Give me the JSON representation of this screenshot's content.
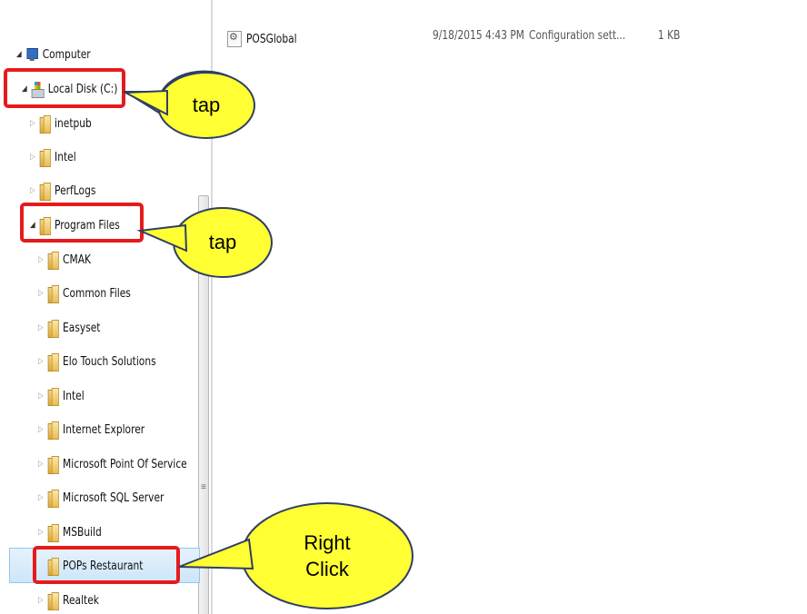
{
  "tree": {
    "computer": "Computer",
    "local_disk": "Local Disk (C:)",
    "items": [
      {
        "label": "inetpub"
      },
      {
        "label": "Intel"
      },
      {
        "label": "PerfLogs"
      }
    ],
    "program_files": "Program Files",
    "program_files_items": [
      {
        "label": "CMAK"
      },
      {
        "label": "Common Files"
      },
      {
        "label": "Easyset"
      },
      {
        "label": "Elo Touch Solutions"
      },
      {
        "label": "Intel"
      },
      {
        "label": "Internet Explorer"
      },
      {
        "label": "Microsoft Point Of Service"
      },
      {
        "label": "Microsoft SQL Server"
      },
      {
        "label": "MSBuild"
      },
      {
        "label": "POPs Restaurant"
      },
      {
        "label": "Realtek"
      }
    ]
  },
  "file": {
    "name": "POSGlobal",
    "date": "9/18/2015 4:43 PM",
    "type": "Configuration sett...",
    "size": "1 KB"
  },
  "callouts": {
    "tap_1": "tap",
    "tap_2": "tap",
    "right_click_line1": "Right",
    "right_click_line2": "Click"
  },
  "colors": {
    "annotation_box": "#e51b1b",
    "bubble_fill": "#ffff33",
    "bubble_stroke": "#2f3f63"
  }
}
